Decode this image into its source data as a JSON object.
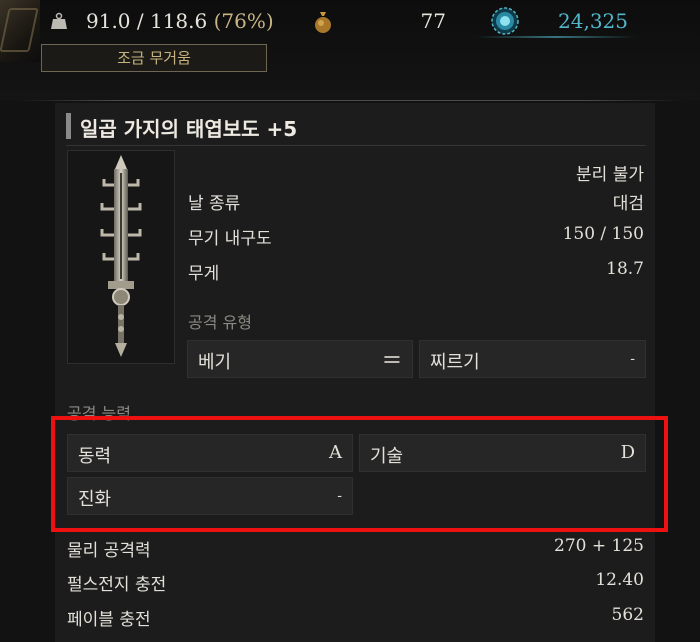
{
  "header": {
    "weight_value": "91.0 / 118.6",
    "weight_pct": "(76%)",
    "load_status": "조금 무거움",
    "coin_count": "77",
    "soul_count": "24,325",
    "soul_color": "#53b6c9",
    "icons": [
      "weight-icon",
      "coin-pouch-icon",
      "soul-orb-icon"
    ]
  },
  "item": {
    "name": "일곱 가지의 태엽보도 +5",
    "detach": "분리 불가",
    "stats": [
      {
        "label": "날 종류",
        "value": "대검"
      },
      {
        "label": "무기 내구도",
        "value": "150 / 150"
      },
      {
        "label": "무게",
        "value": "18.7"
      }
    ],
    "attack_type_label": "공격 유형",
    "attack_types": [
      {
        "label": "베기",
        "value": "="
      },
      {
        "label": "찌르기",
        "value": "-"
      }
    ],
    "scaling_label": "공격 능력",
    "scaling": [
      {
        "label": "동력",
        "value": "A"
      },
      {
        "label": "기술",
        "value": "D"
      },
      {
        "label": "진화",
        "value": "-"
      }
    ],
    "extra_stats": [
      {
        "label": "물리 공격력",
        "value": "270 + 125"
      },
      {
        "label": "펄스전지 충전",
        "value": "12.40"
      },
      {
        "label": "페이블 충전",
        "value": "562"
      }
    ]
  },
  "highlight_color": "#ee1111"
}
